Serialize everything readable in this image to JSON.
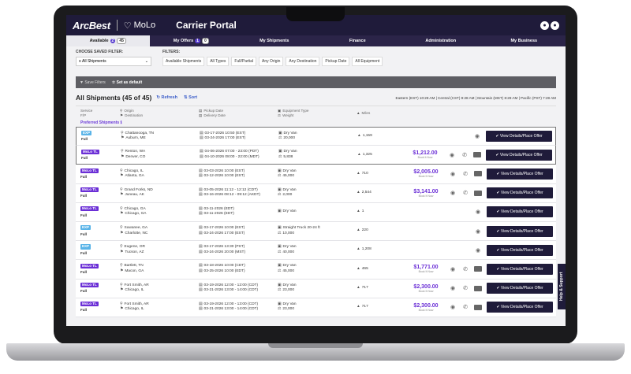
{
  "header": {
    "logo": "ArcBest",
    "molo_mark": "♡",
    "molo": "MoLo",
    "title": "Carrier Portal",
    "user_icons": [
      "●",
      "●"
    ]
  },
  "tabs": [
    {
      "label": "Available",
      "count_a": "2",
      "count_b": "45"
    },
    {
      "label": "My Offers",
      "count_a": "1",
      "count_b": "0"
    },
    {
      "label": "My Shipments"
    },
    {
      "label": "Finance"
    },
    {
      "label": "Administration"
    },
    {
      "label": "My Business"
    }
  ],
  "filters": {
    "saved_label": "CHOOSE SAVED FILTER:",
    "saved_value": "≡ All Shipments",
    "filters_label": "FILTERS:",
    "chips": [
      "Available Shipments",
      "All Types",
      "Full/Partial",
      "Any Origin",
      "Any Destination",
      "Pickup Date",
      "All Equipment"
    ]
  },
  "savebar": {
    "save": "▼ Save Filters",
    "default": "☆ Set as default"
  },
  "list": {
    "title": "All Shipments (45 of 45)",
    "refresh": "↻ Refresh",
    "sort": "⇅ Sort",
    "timezones": "Eastern (EST) 10:28 AM | Central (CST) 9:28 AM | Mountain (MST) 8:28 AM | Pacific (PST) 7:28 AM"
  },
  "columns": {
    "service": "Service",
    "ftl": "F/P",
    "origin": "Origin",
    "destination": "Destination",
    "pickup": "Pickup Date",
    "delivery": "Delivery Date",
    "equipment": "Equipment Type",
    "weight": "Weight",
    "miles": "Miles"
  },
  "preferred_label": "Preferred Shipments ℹ",
  "help": "Help & Support",
  "view_btn": "✔ View Details/Place Offer",
  "rows": [
    {
      "svc": "EXP",
      "kind": "exp",
      "type": "Full",
      "orig": "Chattanooga, TN",
      "dest": "Auburn, ME",
      "pick": "03-17-2026 10:50 (EST)",
      "del": "03-24-2026 17:00 (EST)",
      "equip": "Dry Van",
      "wt": "20,000",
      "miles": "1,159",
      "price": "",
      "sub": ""
    },
    {
      "svc": "MoLo TL",
      "kind": "tl",
      "type": "Full",
      "orig": "Renton, WA",
      "dest": "Denver, CO",
      "pick": "04-06-2026 07:00 - 23:00 (PDT)",
      "del": "04-10-2026 08:00 - 22:00 (MDT)",
      "equip": "Dry Van",
      "wt": "5,838",
      "miles": "1,325",
      "price": "$1,212.00",
      "sub": "Book It Now"
    },
    {
      "svc": "MoLo TL",
      "kind": "tl",
      "type": "Full",
      "orig": "Chicago, IL",
      "dest": "Atlanta, GA",
      "pick": "03-03-2026 10:00 (EST)",
      "del": "03-12-2026 10:00 (EST)",
      "equip": "Dry Van",
      "wt": "45,000",
      "miles": "710",
      "price": "$2,005.00",
      "sub": "Book It Now"
    },
    {
      "svc": "MoLo TL",
      "kind": "tl",
      "type": "Full",
      "orig": "Grand Forks, ND",
      "dest": "Juneau, AK",
      "pick": "03-05-2026 11:12 - 12:12 (CDT)",
      "del": "03-16-2026 08:12 - 09:12 (AKDT)",
      "equip": "Dry Van",
      "wt": "2,000",
      "miles": "2,544",
      "price": "$3,141.00",
      "sub": "Book It Now"
    },
    {
      "svc": "MoLo TL",
      "kind": "tl",
      "type": "Full",
      "orig": "Chicago, GA",
      "dest": "Chicago, GA",
      "pick": "03-11-2026 (EDT)",
      "del": "03-11-2026 (EDT)",
      "equip": "Dry Van",
      "wt": "",
      "miles": "1",
      "price": "",
      "sub": ""
    },
    {
      "svc": "EXP",
      "kind": "exp",
      "type": "Full",
      "orig": "Suwanee, GA",
      "dest": "Charlotte, NC",
      "pick": "03-17-2026 10:00 (EST)",
      "del": "03-24-2026 17:00 (EST)",
      "equip": "Straight Truck 20-24 ft",
      "wt": "10,000",
      "miles": "220",
      "price": "",
      "sub": ""
    },
    {
      "svc": "EXP",
      "kind": "exp",
      "type": "Full",
      "orig": "Eugene, OR",
      "dest": "Tucson, AZ",
      "pick": "03-17-2026 13:30 (PST)",
      "del": "03-24-2026 20:00 (MST)",
      "equip": "Dry Van",
      "wt": "40,000",
      "miles": "1,208",
      "price": "",
      "sub": ""
    },
    {
      "svc": "MoLo TL",
      "kind": "tl",
      "type": "Full",
      "orig": "Bartlett, TN",
      "dest": "Macon, GA",
      "pick": "03-18-2026 10:00 (CDT)",
      "del": "03-25-2026 10:00 (EDT)",
      "equip": "Dry Van",
      "wt": "45,000",
      "miles": "465",
      "price": "$1,771.00",
      "sub": "Book It Now"
    },
    {
      "svc": "MoLo TL",
      "kind": "tl",
      "type": "Full",
      "orig": "Fort Smith, AR",
      "dest": "Chicago, IL",
      "pick": "03-19-2026 12:00 - 12:00 (CDT)",
      "del": "03-21-2026 13:00 - 14:00 (CDT)",
      "equip": "Dry Van",
      "wt": "23,000",
      "miles": "717",
      "price": "$2,300.00",
      "sub": "Book It Now"
    },
    {
      "svc": "MoLo TL",
      "kind": "tl",
      "type": "Full",
      "orig": "Fort Smith, AR",
      "dest": "Chicago, IL",
      "pick": "03-19-2026 12:00 - 13:00 (CDT)",
      "del": "03-21-2026 13:00 - 14:00 (CDT)",
      "equip": "Dry Van",
      "wt": "23,000",
      "miles": "717",
      "price": "$2,300.00",
      "sub": "Book It Now"
    }
  ]
}
